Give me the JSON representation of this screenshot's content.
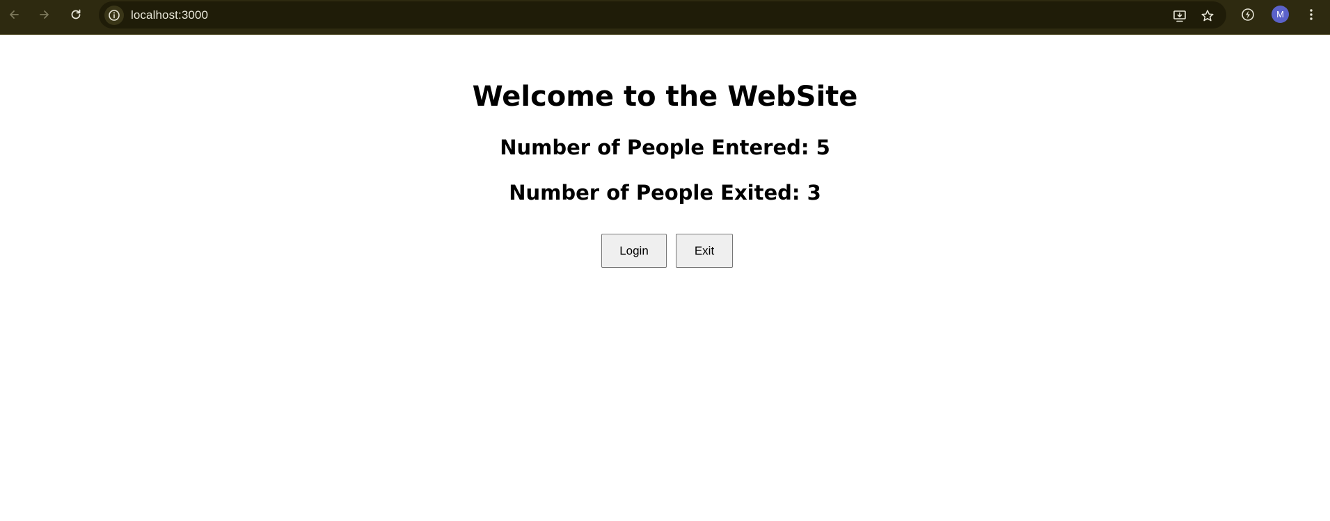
{
  "browser": {
    "url": "localhost:3000",
    "avatar_initial": "M",
    "icons": {
      "back": "back-arrow-icon",
      "forward": "forward-arrow-icon",
      "reload": "reload-icon",
      "site_info": "info-icon",
      "install": "install-app-icon",
      "bookmark": "star-icon",
      "performance": "energy-saver-icon",
      "menu": "kebab-menu-icon"
    },
    "colors": {
      "toolbar": "#2e2a10",
      "omnibox": "#1f1c08",
      "avatar": "#5b62c9"
    }
  },
  "main": {
    "title": "Welcome to the WebSite",
    "entered_label": "Number of People Entered: 5",
    "exited_label": "Number of People Exited: 3",
    "login_button": "Login",
    "exit_button": "Exit"
  }
}
